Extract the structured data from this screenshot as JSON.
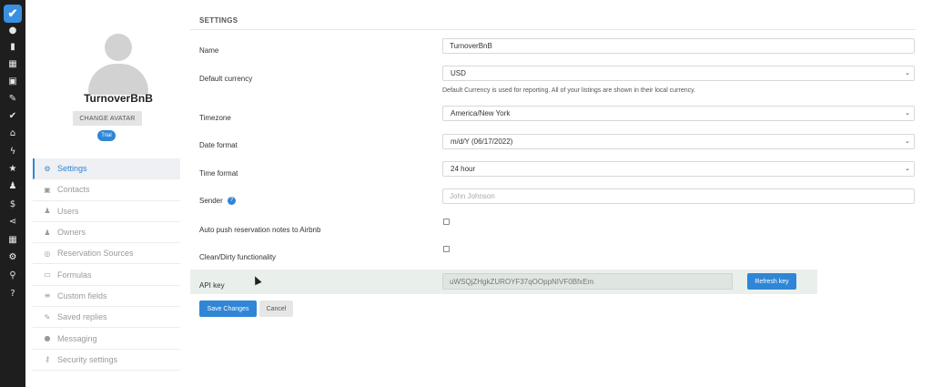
{
  "rail": {
    "items": [
      {
        "icon": "chat-icon",
        "glyph": "●"
      },
      {
        "icon": "bar-chart-icon",
        "glyph": "▮"
      },
      {
        "icon": "calendar-icon",
        "glyph": "▦"
      },
      {
        "icon": "calendar-check-icon",
        "glyph": "▣"
      },
      {
        "icon": "brush-icon",
        "glyph": "✎"
      },
      {
        "icon": "check-icon",
        "glyph": "✔"
      },
      {
        "icon": "home-icon",
        "glyph": "⌂"
      },
      {
        "icon": "bolt-icon",
        "glyph": "ϟ"
      },
      {
        "icon": "star-icon",
        "glyph": "★"
      },
      {
        "icon": "users-icon",
        "glyph": "♟"
      },
      {
        "icon": "dollar-icon",
        "glyph": "$"
      },
      {
        "icon": "share-icon",
        "glyph": "⋖"
      },
      {
        "icon": "grid-icon",
        "glyph": "▦"
      },
      {
        "icon": "gear-icon",
        "glyph": "⚙"
      },
      {
        "icon": "search-icon",
        "glyph": "⚲"
      },
      {
        "icon": "question-icon",
        "glyph": "?"
      }
    ]
  },
  "profile": {
    "name": "TurnoverBnB",
    "change_avatar_label": "CHANGE AVATAR",
    "badge": "Trial"
  },
  "nav": {
    "items": [
      {
        "label": "Settings",
        "icon": "gear-icon",
        "glyph": "⚙"
      },
      {
        "label": "Contacts",
        "icon": "contact-card-icon",
        "glyph": "▣"
      },
      {
        "label": "Users",
        "icon": "users-icon",
        "glyph": "♟"
      },
      {
        "label": "Owners",
        "icon": "owner-icon",
        "glyph": "♟"
      },
      {
        "label": "Reservation Sources",
        "icon": "globe-icon",
        "glyph": "◎"
      },
      {
        "label": "Formulas",
        "icon": "formula-icon",
        "glyph": "▭"
      },
      {
        "label": "Custom fields",
        "icon": "list-icon",
        "glyph": "≡"
      },
      {
        "label": "Saved replies",
        "icon": "edit-icon",
        "glyph": "✎"
      },
      {
        "label": "Messaging",
        "icon": "message-icon",
        "glyph": "●"
      },
      {
        "label": "Security settings",
        "icon": "key-icon",
        "glyph": "⚷"
      }
    ]
  },
  "settings": {
    "section_title": "SETTINGS",
    "name_label": "Name",
    "name_value": "TurnoverBnB",
    "currency_label": "Default currency",
    "currency_value": "USD",
    "currency_hint": "Default Currency is used for reporting. All of your listings are shown in their local currency.",
    "timezone_label": "Timezone",
    "timezone_value": "America/New York",
    "date_format_label": "Date format",
    "date_format_value": "m/d/Y (06/17/2022)",
    "time_format_label": "Time format",
    "time_format_value": "24 hour",
    "sender_label": "Sender",
    "sender_help": "?",
    "sender_placeholder": "John Johnson",
    "auto_push_label": "Auto push reservation notes to Airbnb",
    "clean_dirty_label": "Clean/Dirty functionality",
    "api_key_label": "API key",
    "api_key_value": "uWSQjZHgkZUROYF37qOOppNIVF0BfxEm",
    "refresh_key_label": "Refresh key",
    "save_label": "Save Changes",
    "cancel_label": "Cancel",
    "select_chevron": "⌄"
  }
}
